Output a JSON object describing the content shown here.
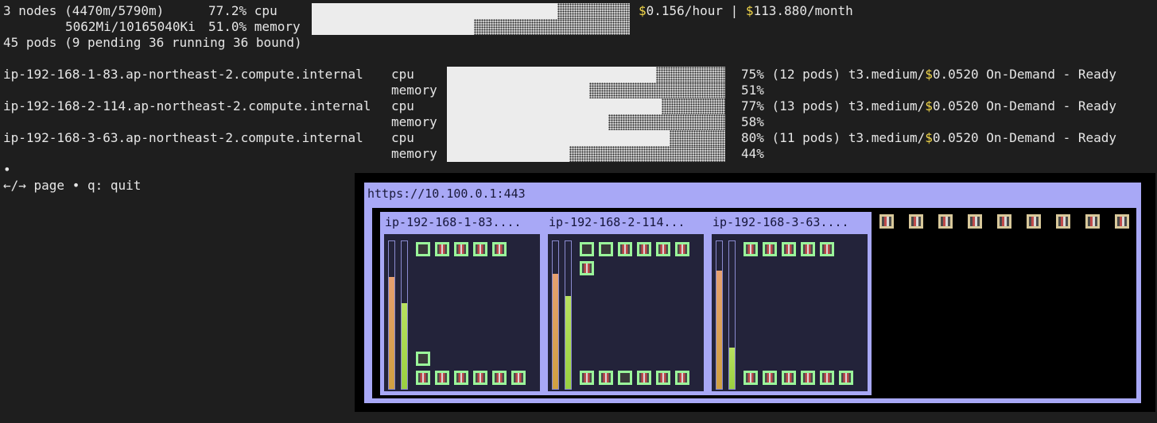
{
  "summary": {
    "nodes_line": "3 nodes (4470m/5790m)",
    "cpu_pct": "77.2% cpu",
    "cpu_fraction": 0.772,
    "mem_line": "5062Mi/10165040Ki",
    "mem_pct": "51.0% memory",
    "mem_fraction": 0.51,
    "cost_hour_sym": "$",
    "cost_hour": "0.156/hour",
    "cost_sep": " | ",
    "cost_month_sym": "$",
    "cost_month": "113.880/month",
    "pods_line": "45 pods (9 pending 36 running 36 bound)"
  },
  "nodes": [
    {
      "name": "ip-192-168-1-83.ap-northeast-2.compute.internal",
      "cpu_label": "cpu",
      "mem_label": "memory",
      "cpu_fraction": 0.75,
      "mem_fraction": 0.51,
      "cpu_pct": "75%",
      "mem_pct": "51%",
      "pods": "(12 pods)",
      "type": "t3.medium/",
      "price_sym": "$",
      "price": "0.0520",
      "status": "On-Demand - Ready",
      "short": "ip-192-168-1-83...."
    },
    {
      "name": "ip-192-168-2-114.ap-northeast-2.compute.internal",
      "cpu_label": "cpu",
      "mem_label": "memory",
      "cpu_fraction": 0.77,
      "mem_fraction": 0.58,
      "cpu_pct": "77%",
      "mem_pct": "58%",
      "pods": "(13 pods)",
      "type": "t3.medium/",
      "price_sym": "$",
      "price": "0.0520",
      "status": "On-Demand - Ready",
      "short": "ip-192-168-2-114..."
    },
    {
      "name": "ip-192-168-3-63.ap-northeast-2.compute.internal",
      "cpu_label": "cpu",
      "mem_label": "memory",
      "cpu_fraction": 0.8,
      "mem_fraction": 0.44,
      "cpu_pct": "80%",
      "mem_pct": "44%",
      "pods": "(11 pods)",
      "type": "t3.medium/",
      "price_sym": "$",
      "price": "0.0520",
      "status": "On-Demand - Ready",
      "short": "ip-192-168-3-63...."
    }
  ],
  "pager": {
    "dot": "•",
    "help": "←/→ page • q: quit"
  },
  "preview": {
    "url": "https://10.100.0.1:443"
  },
  "colors": {
    "money": "#f2d74a",
    "panel": "#a8a8f6",
    "pod": "#9af59a",
    "pending_pod": "#d8c89a"
  }
}
